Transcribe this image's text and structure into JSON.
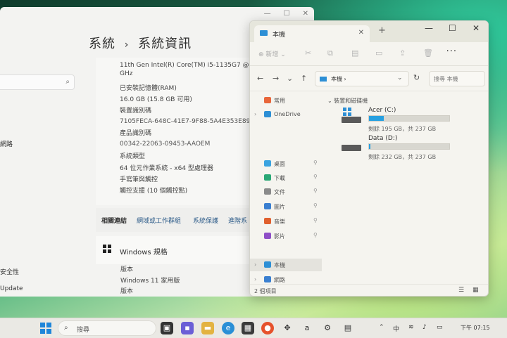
{
  "settings": {
    "breadcrumb_parent": "系統",
    "breadcrumb_sep": "›",
    "page_title": "系統資訊",
    "nav": {
      "network": "網路",
      "security": "安全性",
      "update": "Update"
    },
    "specs": [
      "11th Gen Intel(R) Core(TM) i5-1135G7 @ 2.40G",
      "GHz",
      "已安裝記憶體(RAM)",
      "16.0 GB (15.8 GB 可用)",
      "裝置識別碼",
      "7105FECA-648C-41E7-9F88-5A4E353E897F",
      "產品識別碼",
      "00342-22063-09453-AAOEM",
      "系統類型",
      "64 位元作業系統 - x64 型處理器",
      "手寫筆與觸控",
      "觸控支援 (10 個觸控點)"
    ],
    "related": {
      "label": "相關連結",
      "link1": "網域或工作群組",
      "link2": "系統保護",
      "link3": "進階系"
    },
    "windows_spec": {
      "label": "Windows 規格",
      "details": [
        "版本",
        "Windows 11 家用版",
        "版本"
      ]
    }
  },
  "explorer": {
    "tab_title": "本機",
    "new_label": "新增",
    "address": "本機  ›",
    "search_placeholder": "搜尋 本機",
    "nav_items": [
      {
        "label": "常用",
        "icon": "home-icon",
        "color": "#e8663a",
        "pin": false,
        "chev": false
      },
      {
        "label": "OneDrive",
        "icon": "cloud-icon",
        "color": "#2d8fd5",
        "pin": false,
        "chev": true
      },
      {
        "label": "桌面",
        "icon": "desktop-icon",
        "color": "#3aa3e0",
        "pin": true,
        "chev": false
      },
      {
        "label": "下載",
        "icon": "download-icon",
        "color": "#2aa876",
        "pin": true,
        "chev": false
      },
      {
        "label": "文件",
        "icon": "document-icon",
        "color": "#8a8a8a",
        "pin": true,
        "chev": false
      },
      {
        "label": "圖片",
        "icon": "picture-icon",
        "color": "#3a7fd0",
        "pin": true,
        "chev": false
      },
      {
        "label": "音樂",
        "icon": "music-icon",
        "color": "#e0602e",
        "pin": true,
        "chev": false
      },
      {
        "label": "影片",
        "icon": "video-icon",
        "color": "#8f4fc7",
        "pin": true,
        "chev": false
      },
      {
        "label": "本機",
        "icon": "this-pc-icon",
        "color": "#2d8fd5",
        "pin": false,
        "chev": true,
        "selected": true
      },
      {
        "label": "網路",
        "icon": "network-icon",
        "color": "#3a7fd0",
        "pin": false,
        "chev": true
      }
    ],
    "section_title": "裝置和磁碟機",
    "drives": [
      {
        "name": "Acer (C:)",
        "free_text": "剩餘 195 GB，共 237 GB",
        "used_fraction": 0.18,
        "system": true
      },
      {
        "name": "Data (D:)",
        "free_text": "剩餘 232 GB，共 237 GB",
        "used_fraction": 0.02,
        "system": false
      }
    ],
    "status": "2 個項目"
  },
  "taskbar": {
    "search_text": "搜尋",
    "tray_lang": "中",
    "time": "下午 07:15"
  }
}
